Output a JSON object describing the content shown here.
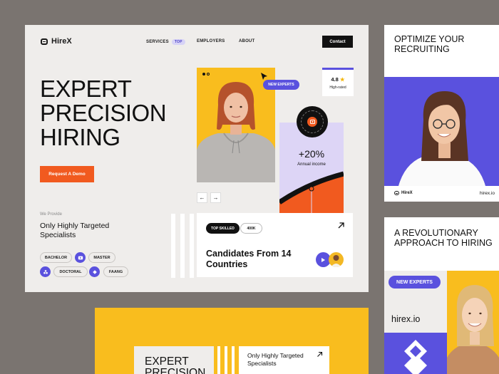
{
  "main": {
    "logo": "HireX",
    "nav": {
      "services": "SERVICES",
      "services_badge": "TOP",
      "employers": "EMPLOYERS",
      "about": "ABOUT",
      "contact": "Contact"
    },
    "hero_lines": [
      "EXPERT",
      "PRECISION",
      "HIRING"
    ],
    "cta": "Request A Demo",
    "we_provide": "We Provide",
    "provide_title": "Only Highly Targeted Specialists",
    "chips": [
      "BACHELOR",
      "MASTER",
      "DOCTORAL",
      "FAANG"
    ],
    "new_experts": "NEW EXPERTS",
    "rating": {
      "value": "4.8",
      "label": "High-rated"
    },
    "income": {
      "value": "+20%",
      "label": "Annual income"
    },
    "candidates": {
      "tag": "TOP SKILLED",
      "count": "400K",
      "title": "Candidates From 14 Countries"
    }
  },
  "right_top": {
    "title": "OPTIMIZE YOUR RECRUITING",
    "logo": "HireX",
    "url": "hirex.io"
  },
  "right_bottom": {
    "title": "A REVOLUTIONARY APPROACH TO HIRING",
    "pill": "NEW EXPERTS",
    "url": "hirex.io"
  },
  "bottom": {
    "title": "EXPERT PRECISION",
    "subtitle": "Only Highly Targeted Specialists"
  },
  "colors": {
    "background": "#7a7470",
    "card": "#efedeb",
    "accent_orange": "#f15a1f",
    "accent_purple": "#5a51de",
    "yellow": "#f9bd1e",
    "lavender": "#ddd5f6"
  }
}
